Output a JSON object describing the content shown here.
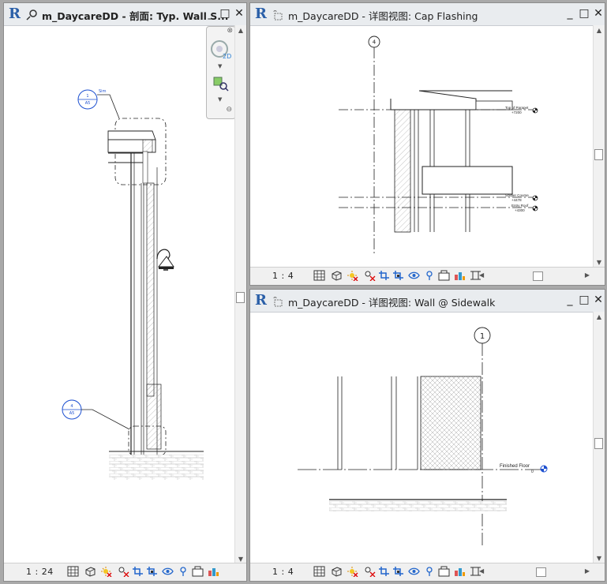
{
  "app": {
    "logo_letter": "R",
    "accent": "#2a5fa8"
  },
  "windows": {
    "section": {
      "title": "m_DaycareDD - 剖面: Typ. Wall S...",
      "scale": "1 : 24",
      "view_icon": "section-view-icon",
      "callouts": {
        "top": {
          "number": "1",
          "sheet": "A5",
          "label": "Sim"
        },
        "bottom": {
          "number": "4",
          "sheet": "A5"
        }
      }
    },
    "cap_flashing": {
      "title": "m_DaycareDD - 详图视图: Cap Flashing",
      "scale": "1 : 4",
      "view_icon": "detail-view-icon",
      "grid_bubble": "4",
      "levels": [
        {
          "name": "Top of Parapet",
          "elev": "+7200"
        },
        {
          "name": "Soldier Course",
          "elev": "+4478"
        },
        {
          "name": "Entry Roof",
          "elev": "+4300"
        }
      ]
    },
    "wall_sidewalk": {
      "title": "m_DaycareDD - 详图视图: Wall @ Sidewalk",
      "scale": "1 : 4",
      "view_icon": "detail-view-icon",
      "grid_bubble": "1",
      "level": {
        "name": "Finished Floor",
        "elev": "0"
      }
    }
  },
  "window_controls": {
    "minimize": "_",
    "maximize": "□",
    "close": "✕"
  },
  "status_tools": [
    "detail-level-icon",
    "visual-style-icon",
    "sun-path-icon",
    "shadows-icon",
    "crop-view-icon",
    "show-crop-icon",
    "temporary-hide-icon",
    "reveal-hidden-icon",
    "worksharing-icon",
    "analysis-icon",
    "highlight-icon",
    "constraints-icon"
  ],
  "scroll_arrows": {
    "up": "▲",
    "down": "▼",
    "left": "◀",
    "right": "▶"
  }
}
